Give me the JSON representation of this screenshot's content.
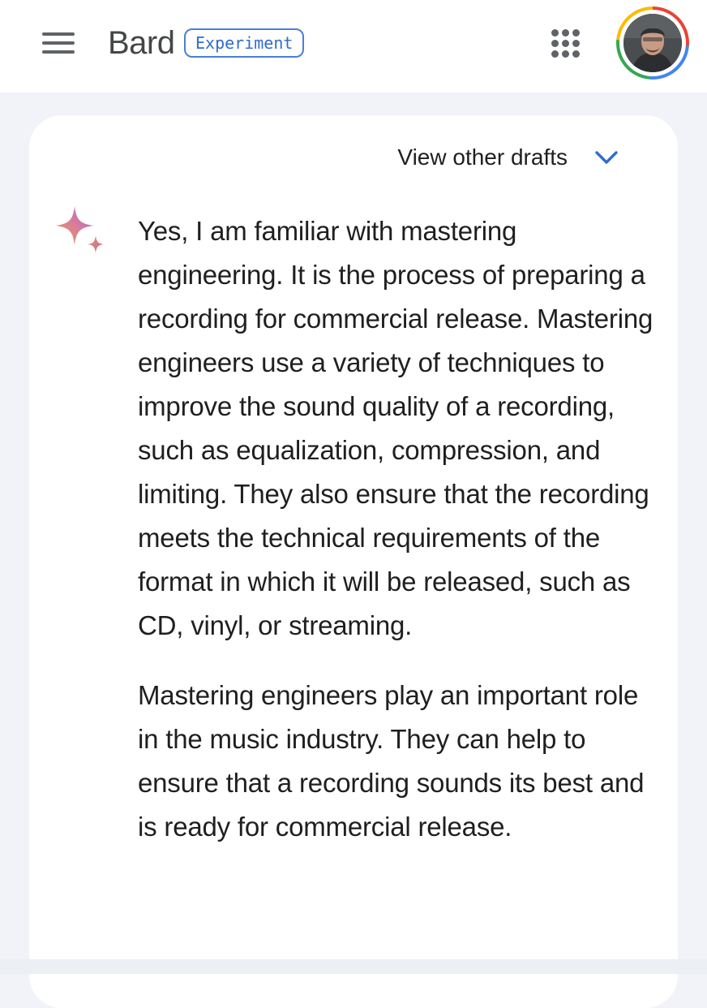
{
  "app": {
    "title": "Bard",
    "badge": "Experiment"
  },
  "header": {
    "menu_icon": "hamburger-menu-icon",
    "apps_icon": "google-apps-grid-icon",
    "avatar": "account-avatar"
  },
  "response": {
    "view_drafts_label": "View other drafts",
    "drafts_icon": "chevron-down-icon",
    "assistant_icon": "bard-sparkle-icon",
    "paragraphs": [
      "Yes, I am familiar with mastering engineering. It is the process of preparing a recording for commercial release. Mastering engineers use a variety of techniques to improve the sound quality of a recording, such as equalization, compression, and limiting. They also ensure that the recording meets the technical requirements of the format in which it will be released, such as CD, vinyl, or streaming.",
      "Mastering engineers play an important role in the music industry. They can help to ensure that a recording sounds its best and is ready for commercial release."
    ]
  },
  "colors": {
    "background": "#f1f3f8",
    "card": "#ffffff",
    "accent_blue": "#2f6bd1",
    "icon_grey": "#5f6368",
    "text": "#1f1f1f"
  }
}
